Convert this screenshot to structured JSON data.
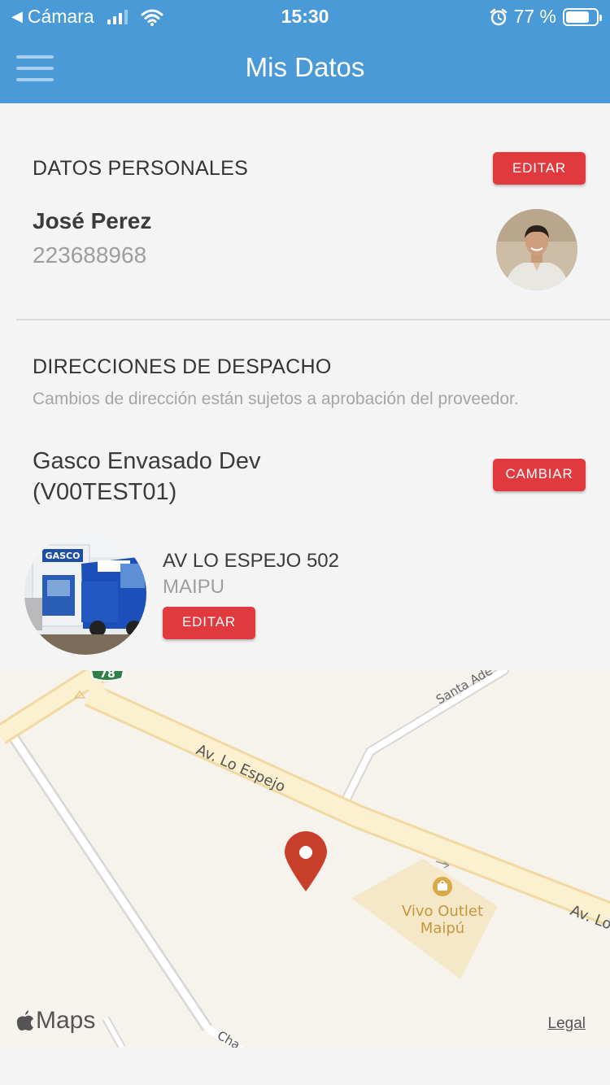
{
  "status_bar": {
    "back_app": "Cámara",
    "time": "15:30",
    "battery": "77 %",
    "battery_level": 0.77
  },
  "nav": {
    "title": "Mis Datos"
  },
  "personal": {
    "section_title": "DATOS PERSONALES",
    "edit_label": "EDITAR",
    "name": "José Perez",
    "phone": "223688968"
  },
  "shipping": {
    "section_title": "DIRECCIONES DE DESPACHO",
    "subtitle": "Cambios de dirección están sujetos a aprobación del proveedor.",
    "branch_name": "Gasco Envasado Dev (V00TEST01)",
    "change_label": "CAMBIAR",
    "address_line1": "AV LO ESPEJO 502",
    "address_line2": "MAIPU",
    "edit_label": "EDITAR",
    "store_sign": "GASCO"
  },
  "map": {
    "route_badge": "78",
    "street_main": "Av. Lo Espejo",
    "street_main_right": "Av. Lo",
    "street_top": "Santa Ade",
    "street_bottom": "Cha",
    "poi_name_line1": "Vivo Outlet",
    "poi_name_line2": "Maipú",
    "brand": "Maps",
    "legal": "Legal",
    "pin_color": "#c8402c",
    "poi_color": "#c8953a"
  },
  "colors": {
    "header": "#4a9ad8",
    "button": "#e0393e"
  }
}
